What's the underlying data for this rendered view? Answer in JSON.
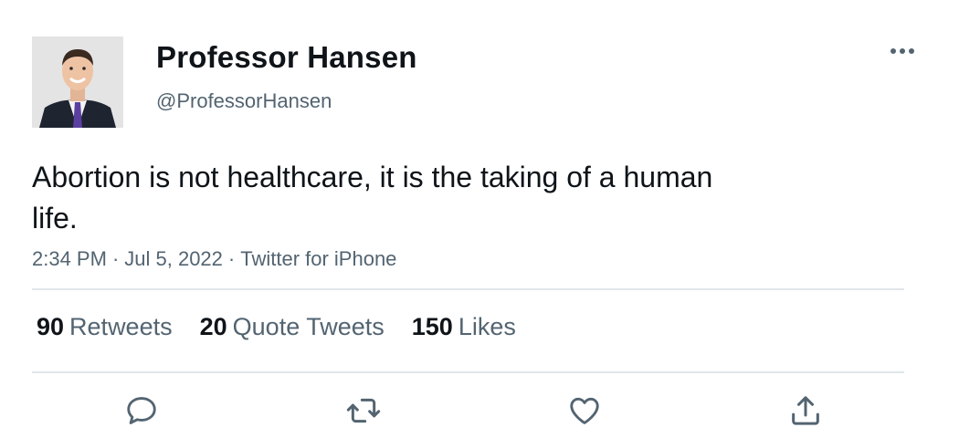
{
  "author": {
    "display_name": "Professor Hansen",
    "handle": "@ProfessorHansen"
  },
  "tweet": {
    "text": "Abortion is not healthcare, it is the taking of a human life.",
    "time": "2:34 PM",
    "date": "Jul 5, 2022",
    "source": "Twitter for iPhone",
    "separator": "·"
  },
  "stats": {
    "retweets": {
      "count": "90",
      "label": "Retweets"
    },
    "quotes": {
      "count": "20",
      "label": "Quote Tweets"
    },
    "likes": {
      "count": "150",
      "label": "Likes"
    }
  },
  "icons": {
    "more": "more-horizontal-icon",
    "reply": "reply-icon",
    "retweet": "retweet-icon",
    "like": "heart-icon",
    "share": "share-icon"
  },
  "colors": {
    "text": "#0f1419",
    "secondary": "#536471",
    "divider": "#e1e6ea"
  }
}
